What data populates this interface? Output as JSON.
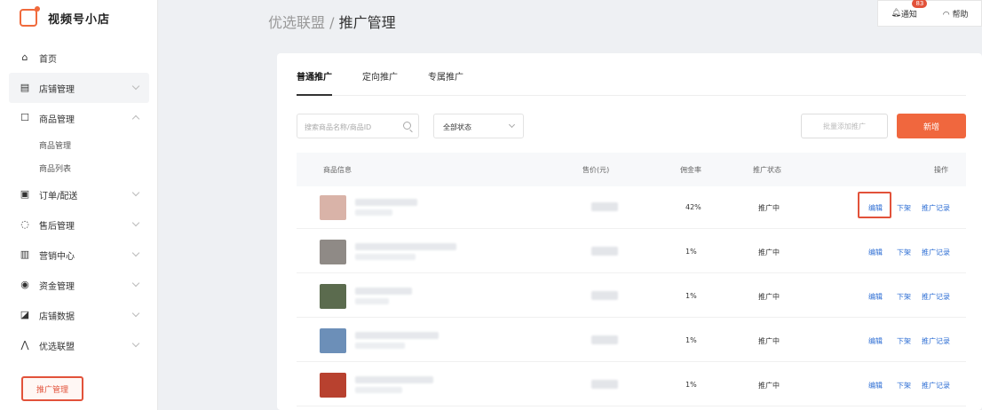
{
  "app": {
    "title": "视频号小店"
  },
  "sidebar": {
    "items": [
      {
        "label": "首页",
        "icon": "home-icon"
      },
      {
        "label": "店铺管理",
        "icon": "store-icon"
      },
      {
        "label": "商品管理",
        "icon": "bag-icon"
      },
      {
        "label": "订单/配送",
        "icon": "order-icon"
      },
      {
        "label": "售后管理",
        "icon": "headset-icon"
      },
      {
        "label": "营销中心",
        "icon": "marketing-icon"
      },
      {
        "label": "资金管理",
        "icon": "money-icon"
      },
      {
        "label": "店铺数据",
        "icon": "data-icon"
      },
      {
        "label": "优选联盟",
        "icon": "alliance-icon"
      }
    ],
    "goods_sub": [
      "商品管理",
      "商品列表"
    ],
    "active_sub": "推广管理"
  },
  "breadcrumb": {
    "parent": "优选联盟",
    "sep": " / ",
    "current": "推广管理"
  },
  "topbar": {
    "notice_label": "通知",
    "notice_count": "83",
    "help_label": "帮助"
  },
  "tabs": [
    "普通推广",
    "定向推广",
    "专属推广"
  ],
  "filters": {
    "search_placeholder": "搜索商品名称/商品ID",
    "status_value": "全部状态"
  },
  "buttons": {
    "batch_label": "批量添加推广",
    "add_label": "新增"
  },
  "table": {
    "headers": [
      "商品信息",
      "售价(元)",
      "佣金率",
      "推广状态",
      "操作"
    ],
    "rows": [
      {
        "rate": "42%",
        "status": "推广中",
        "thumb": "#d9b3a8"
      },
      {
        "rate": "1%",
        "status": "推广中",
        "thumb": "#8f8a86"
      },
      {
        "rate": "1%",
        "status": "推广中",
        "thumb": "#5b6b4e"
      },
      {
        "rate": "1%",
        "status": "推广中",
        "thumb": "#6c8fb8"
      },
      {
        "rate": "1%",
        "status": "推广中",
        "thumb": "#b8412f"
      }
    ],
    "ops": {
      "edit": "编辑",
      "remove": "下架",
      "record": "推广记录"
    }
  }
}
